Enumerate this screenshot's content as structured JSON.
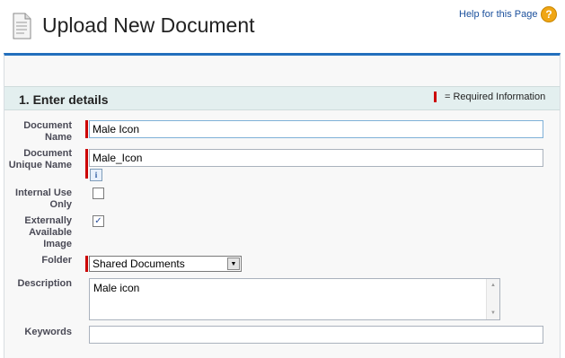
{
  "header": {
    "title": "Upload New Document",
    "help_link": "Help for this Page",
    "help_icon_glyph": "?"
  },
  "section": {
    "title": "1. Enter details",
    "required_legend": "= Required Information"
  },
  "form": {
    "document_name": {
      "label": "Document Name",
      "value": "Male Icon",
      "required": true
    },
    "document_unique_name": {
      "label": "Document Unique Name",
      "value": "Male_Icon",
      "required": true,
      "info_glyph": "i"
    },
    "internal_use_only": {
      "label": "Internal Use Only",
      "checked": false
    },
    "externally_available_image": {
      "label": "Externally Available Image",
      "checked": true,
      "check_glyph": "✓"
    },
    "folder": {
      "label": "Folder",
      "selected": "Shared Documents",
      "required": true,
      "arrow_glyph": "▼"
    },
    "description": {
      "label": "Description",
      "value": "Male icon",
      "scroll_up_glyph": "▲",
      "scroll_down_glyph": "▼"
    },
    "keywords": {
      "label": "Keywords",
      "value": ""
    }
  },
  "colors": {
    "accent": "#236fbd",
    "required": "#cc0000",
    "section_bg": "#e3efef",
    "help_icon": "#f0a615"
  }
}
